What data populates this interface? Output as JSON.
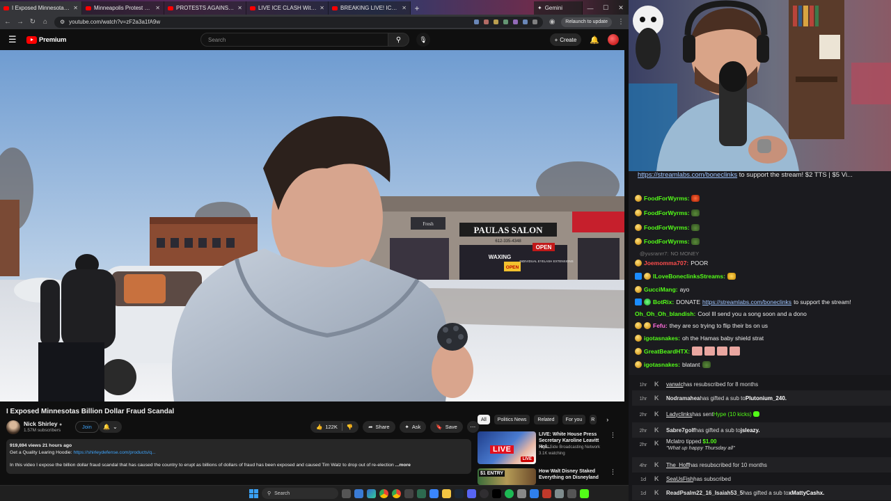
{
  "browser": {
    "tabs": [
      {
        "title": "I Exposed Minnesotas Billion D"
      },
      {
        "title": "Minneapolis Protest 1/15 - You"
      },
      {
        "title": "PROTESTS AGAINST ICE CONTI"
      },
      {
        "title": "LIVE ICE CLASH With Protester"
      },
      {
        "title": "BREAKING LIVE! ICE protestors"
      }
    ],
    "gemini_tab": "Gemini",
    "url": "youtube.com/watch?v=zF2a3a1fA9w",
    "relaunch": "Relaunch to update"
  },
  "youtube": {
    "logo_text": "Premium",
    "search_placeholder": "Search",
    "create_label": "Create",
    "video": {
      "title": "I Exposed Minnesotas Billion Dollar Fraud Scandal",
      "scene_text": {
        "salon_sign": "PAULAS SALON",
        "salon_phone": "612-335-4348",
        "open_sign": "OPEN",
        "waxing": "WAXING",
        "open_sign_2": "OPEN",
        "store_sign": "Fresh",
        "extensions": "INDIVIDUAL EYELASH EXTENSIONS"
      }
    },
    "channel": {
      "name": "Nick Shirley",
      "subs": "1.57M subscribers",
      "join": "Join"
    },
    "actions": {
      "likes": "122K",
      "share": "Share",
      "ask": "Ask",
      "save": "Save"
    },
    "description": {
      "meta": "919,694 views  21 hours ago",
      "line1_prefix": "Get a Quality Learing Hoodie: ",
      "line1_link": "https://shirleydefense.com/products/q...",
      "line2": "In this video I expose the billion dollar fraud scandal that has caused the country to erupt as billions of dollars of fraud has been exposed and caused Tim Walz to drop out of re-election",
      "more": "...more"
    },
    "chips": [
      "All",
      "Politics News",
      "Related",
      "For you",
      "R"
    ],
    "recommendations": [
      {
        "title": "LIVE: White House Press Secretary Karoline Leavitt Hol...",
        "channel": "Right Side Broadcasting Network",
        "views": "3.1K watching",
        "badge": "LIVE",
        "thumb_text": "LIVE"
      },
      {
        "title": "How Walt Disney Staked Everything on Disneyland",
        "channel": "",
        "views": "",
        "badge": "",
        "thumb_text": "$1 ENTRY"
      }
    ]
  },
  "taskbar": {
    "search": "Search"
  },
  "chat": {
    "top_link": "https://streamlabs.com/boneclinks",
    "top_text": " to support the stream! $2 TTS | $5 Vi...",
    "messages": [
      {
        "user": "FoodForWyrms:",
        "text": "",
        "color": "#53fc18",
        "emote": "red"
      },
      {
        "user": "FoodForWyrms:",
        "text": "",
        "color": "#53fc18",
        "emote": "frog"
      },
      {
        "user": "FoodForWyrms:",
        "text": "",
        "color": "#53fc18",
        "emote": "frog"
      },
      {
        "user": "FoodForWyrms:",
        "text": "",
        "color": "#53fc18",
        "emote": "frog"
      },
      {
        "user": "@yusranrr7:",
        "text": "NO MONEY",
        "color": "#777777",
        "emote": ""
      },
      {
        "user": "Joemomma707:",
        "text": "POOR",
        "color": "#ff4d4d",
        "emote": ""
      },
      {
        "user": "ILoveBoneclinksStreams:",
        "text": "",
        "color": "#53fc18",
        "emote": "gold"
      },
      {
        "user": "GucciMang:",
        "text": "ayo",
        "color": "#53fc18",
        "emote": ""
      },
      {
        "user": "BotRix:",
        "text": "DONATE ",
        "link": "https://streamlabs.com/boneclinks",
        "after": " to support the stream!",
        "color": "#53fc18",
        "emote": ""
      },
      {
        "user": "Oh_Oh_Oh_blandish:",
        "text": "Cool Ill send you a song soon and a dono",
        "color": "#53fc18",
        "emote": ""
      },
      {
        "user": "Fefu:",
        "text": "they are so trying to flip their bs on us",
        "color": "#ff6bdc",
        "emote": ""
      },
      {
        "user": "igotasnakes:",
        "text": "oh the Hamas baby shield strat",
        "color": "#53fc18",
        "emote": ""
      },
      {
        "user": "GreatBeardHTX:",
        "text": "",
        "color": "#53fc18",
        "emote": "pink"
      },
      {
        "user": "igotasnakes:",
        "text": "blatant",
        "color": "#53fc18",
        "emote": "frog"
      }
    ]
  },
  "events": [
    {
      "time": "1hr",
      "who": "vanwic",
      "text": " has resubscribed for 8 months",
      "extra": "",
      "extra2": ""
    },
    {
      "time": "1hr",
      "who": "Nodramahea",
      "text": " has gifted a sub to ",
      "extra": "Plutonium_240.",
      "extra2": ""
    },
    {
      "time": "2hr",
      "who": "Ladyclinks",
      "text": " has sent ",
      "extra": "Hype (10 kicks)",
      "extra2": ""
    },
    {
      "time": "2hr",
      "who": "Sabre7golf",
      "text": " has gifted a sub to ",
      "extra": "jsleazy.",
      "extra2": ""
    },
    {
      "time": "2hr",
      "who": "Mclatro",
      "text": " tipped ",
      "extra": "$1.00",
      "extra2": "\"What up happy Thursday all\""
    },
    {
      "time": "4hr",
      "who": "The_Hoff",
      "text": " has resubscribed for 10 months",
      "extra": "",
      "extra2": ""
    },
    {
      "time": "1d",
      "who": "SeaUsFish",
      "text": " has subscribed",
      "extra": "",
      "extra2": ""
    },
    {
      "time": "1d",
      "who": "ReadPsalm22_16_Isaiah53_5",
      "text": " has gifted a sub to ",
      "extra": "xMattyCashx.",
      "extra2": ""
    }
  ],
  "colors": {
    "youtube_red": "#ff0000",
    "link_blue": "#3ea6ff",
    "kick_green": "#53fc18"
  }
}
